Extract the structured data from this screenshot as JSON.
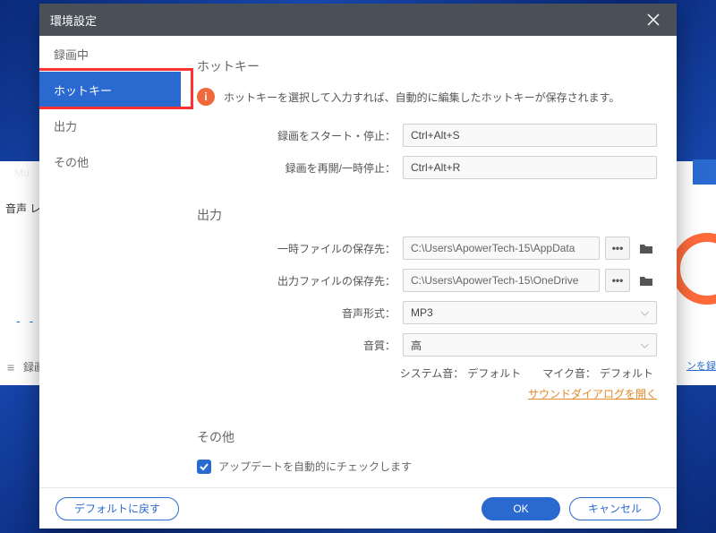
{
  "dialog": {
    "title": "環境設定"
  },
  "sidebar": {
    "items": [
      {
        "label": "録画中"
      },
      {
        "label": "ホットキー"
      },
      {
        "label": "出力"
      },
      {
        "label": "その他"
      }
    ],
    "active_index": 1
  },
  "sections": {
    "hotkey": {
      "title": "ホットキー",
      "info": "ホットキーを選択して入力すれば、自動的に編集したホットキーが保存されます。",
      "rows": [
        {
          "label": "録画をスタート・停止：",
          "value": "Ctrl+Alt+S"
        },
        {
          "label": "録画を再開/一時停止：",
          "value": "Ctrl+Alt+R"
        }
      ]
    },
    "output": {
      "title": "出力",
      "temp_label": "一時ファイルの保存先：",
      "temp_value": "C:\\Users\\ApowerTech-15\\AppData",
      "out_label": "出力ファイルの保存先：",
      "out_value": "C:\\Users\\ApowerTech-15\\OneDrive",
      "format_label": "音声形式：",
      "format_value": "MP3",
      "quality_label": "音質：",
      "quality_value": "高",
      "system_label": "システム音：",
      "system_value": "デフォルト",
      "mic_label": "マイク音：",
      "mic_value": "デフォルト",
      "sound_link": "サウンドダイアログを開く"
    },
    "other": {
      "title": "その他",
      "auto_update": "アップデートを自動的にチェックします"
    }
  },
  "footer": {
    "reset": "デフォルトに戻す",
    "ok": "OK",
    "cancel": "キャンセル"
  },
  "bg": {
    "audio_label": "音声 レ",
    "rec_label": "録画",
    "edge_link": "ンを録",
    "mu": "Mu"
  }
}
